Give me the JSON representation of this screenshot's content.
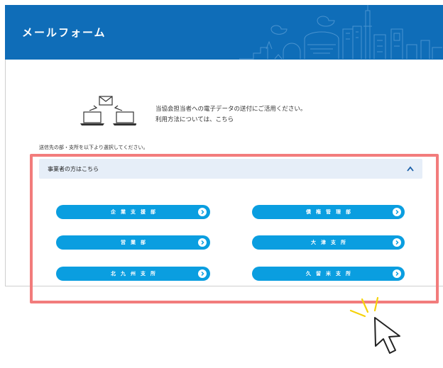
{
  "header": {
    "title": "メールフォーム"
  },
  "intro": {
    "line1": "当協会担当者への電子データの送付にご活用ください。",
    "line2": "利用方法については、こちら"
  },
  "instruction": "送信先の部・支所を以下より選択してください。",
  "accordion": {
    "label": "事業者の方はこちら",
    "state": "expanded"
  },
  "departments": [
    "企業支援部",
    "債権管理部",
    "営業部",
    "大津支所",
    "北九州支所",
    "久留米支所"
  ],
  "colors": {
    "header_bg": "#0f6db8",
    "button_bg": "#0a9ee0",
    "accordion_bg": "#e6eef8",
    "highlight": "#f27c7c",
    "sparkle": "#f5d20a"
  },
  "icons": [
    "computers-email-icon",
    "chevron-up-icon",
    "arrow-right-icon",
    "cursor-icon"
  ]
}
